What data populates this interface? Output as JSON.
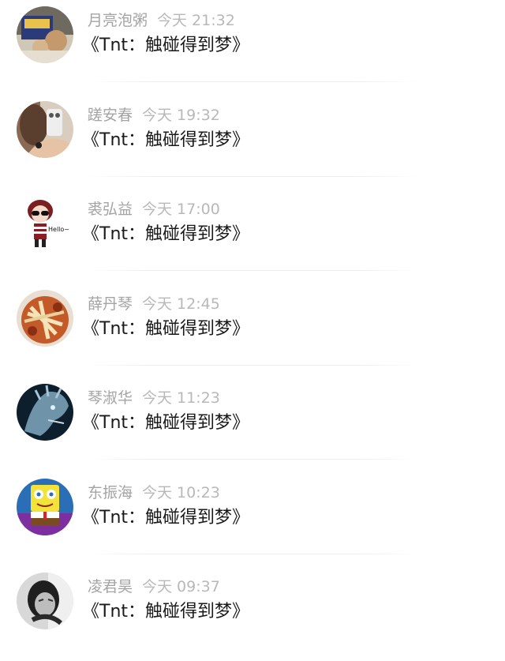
{
  "messages": [
    {
      "name": "月亮泡粥",
      "time": "今天 21:32",
      "text": "《Tnt：触碰得到梦》",
      "avatar_icon": "photo-avatar-icon"
    },
    {
      "name": "蹉安春",
      "time": "今天 19:32",
      "text": "《Tnt：触碰得到梦》",
      "avatar_icon": "selfie-avatar-icon"
    },
    {
      "name": "裘弘益",
      "time": "今天 17:00",
      "text": "《Tnt：触碰得到梦》",
      "avatar_icon": "cartoon-hello-avatar-icon"
    },
    {
      "name": "薛丹琴",
      "time": "今天 12:45",
      "text": "《Tnt：触碰得到梦》",
      "avatar_icon": "food-avatar-icon"
    },
    {
      "name": "琴淑华",
      "time": "今天 11:23",
      "text": "《Tnt：触碰得到梦》",
      "avatar_icon": "dragon-avatar-icon"
    },
    {
      "name": "东振海",
      "time": "今天 10:23",
      "text": "《Tnt：触碰得到梦》",
      "avatar_icon": "spongebob-avatar-icon"
    },
    {
      "name": "凌君昊",
      "time": "今天 09:37",
      "text": "《Tnt：触碰得到梦》",
      "avatar_icon": "bw-portrait-avatar-icon"
    }
  ],
  "avatar_sticker_text": "Hello~"
}
